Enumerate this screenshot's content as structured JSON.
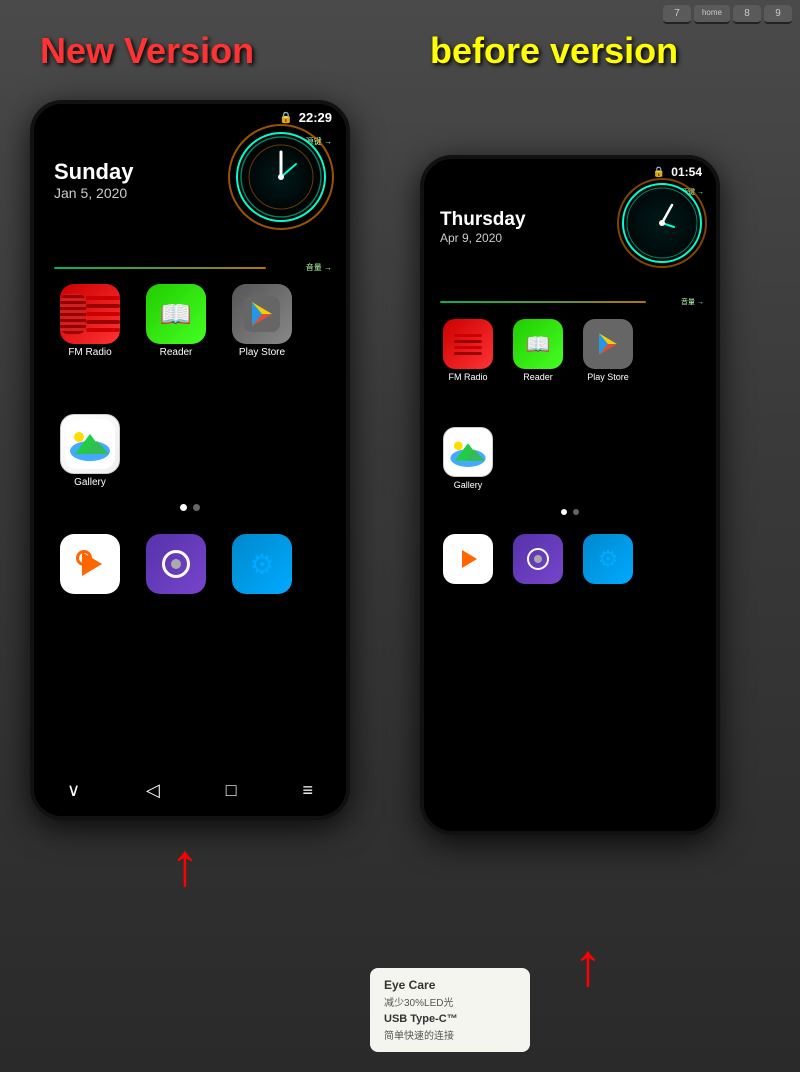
{
  "labels": {
    "new_version": "New Version",
    "before_version": "before version"
  },
  "phone_new": {
    "time": "22:29",
    "day": "Sunday",
    "date": "Jan 5, 2020",
    "apps_row1": [
      {
        "name": "FM Radio",
        "icon": "fm"
      },
      {
        "name": "Reader",
        "icon": "reader"
      },
      {
        "name": "Play Store",
        "icon": "playstore"
      }
    ],
    "apps_row2": [
      {
        "name": "Gallery",
        "icon": "gallery"
      }
    ],
    "apps_row3": [
      {
        "name": "",
        "icon": "video"
      },
      {
        "name": "",
        "icon": "eye"
      },
      {
        "name": "",
        "icon": "settings"
      }
    ],
    "nav": [
      "‹",
      "◁",
      "□",
      "≡"
    ]
  },
  "phone_before": {
    "time": "01:54",
    "day": "Thursday",
    "date": "Apr 9, 2020",
    "apps_row1": [
      {
        "name": "FM Radio",
        "icon": "fm"
      },
      {
        "name": "Reader",
        "icon": "reader"
      },
      {
        "name": "Play Store",
        "icon": "playstore"
      }
    ],
    "apps_row2": [
      {
        "name": "Gallery",
        "icon": "gallery"
      }
    ],
    "apps_row3": [
      {
        "name": "",
        "icon": "video"
      },
      {
        "name": "",
        "icon": "eye"
      },
      {
        "name": "",
        "icon": "settings"
      }
    ]
  },
  "bottom_card": {
    "line1": "Eye Care",
    "line2": "减少30%LED光",
    "line3": "USB Type-C™",
    "line4": "简单快速的连接"
  }
}
